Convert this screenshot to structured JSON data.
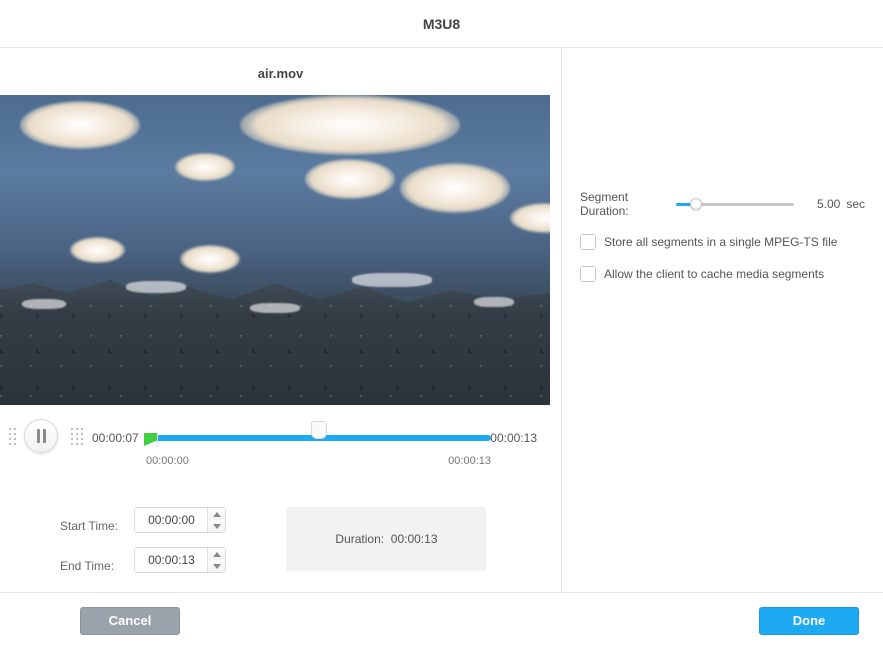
{
  "header": {
    "title": "M3U8"
  },
  "video": {
    "filename": "air.mov",
    "current_time": "00:00:07",
    "total_time": "00:00:13",
    "range_start_tick": "00:00:00",
    "range_end_tick": "00:00:13"
  },
  "fields": {
    "start_label": "Start Time:",
    "start_value": "00:00:00",
    "end_label": "End Time:",
    "end_value": "00:00:13",
    "duration_label": "Duration:",
    "duration_value": "00:00:13"
  },
  "options": {
    "segment_label": "Segment Duration:",
    "segment_value": "5.00",
    "segment_unit": "sec",
    "store_single_label": "Store all segments in a single MPEG-TS file",
    "allow_cache_label": "Allow the client to cache media segments"
  },
  "footer": {
    "cancel": "Cancel",
    "done": "Done"
  }
}
